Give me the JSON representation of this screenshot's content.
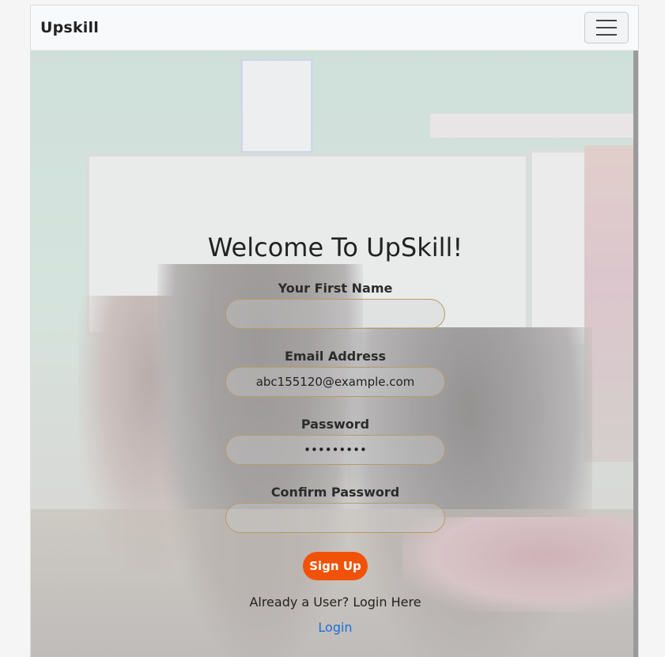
{
  "navbar": {
    "brand": "Upskill",
    "menu_icon": "hamburger-menu-icon"
  },
  "form": {
    "title": "Welcome To UpSkill!",
    "first_name": {
      "label": "Your First Name",
      "value": ""
    },
    "email": {
      "label": "Email Address",
      "value": "abc155120@example.com"
    },
    "password": {
      "label": "Password",
      "value": "•••••••••"
    },
    "confirm_password": {
      "label": "Confirm Password",
      "value": ""
    },
    "submit_label": "Sign Up",
    "already_text": "Already a User? Login Here",
    "login_link": "Login"
  },
  "colors": {
    "primary": "#f15208",
    "link": "#1a6fd8",
    "input_border": "#b79a68"
  }
}
